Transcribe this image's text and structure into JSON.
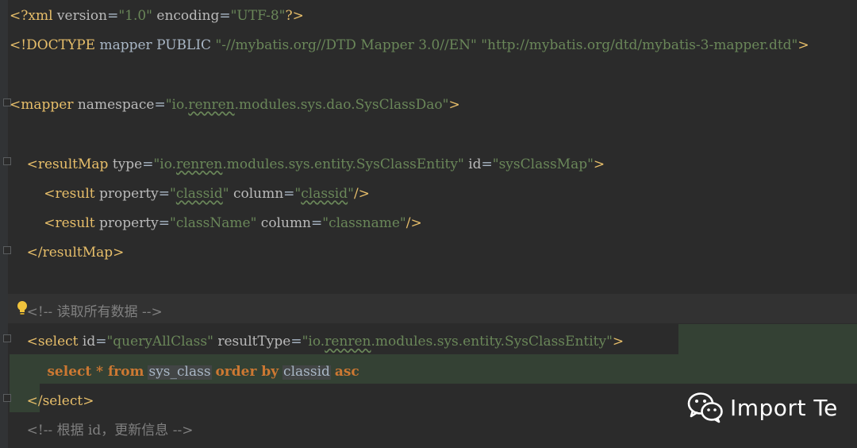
{
  "lines": [
    {
      "name": "xml-declaration-line",
      "segments": [
        {
          "t": "<?xml ",
          "c": "bracket"
        },
        {
          "t": "version",
          "c": "attr"
        },
        {
          "t": "=",
          "c": "pl"
        },
        {
          "t": "\"1.0\"",
          "c": "val"
        },
        {
          "t": " ",
          "c": "pl"
        },
        {
          "t": "encoding",
          "c": "attr"
        },
        {
          "t": "=",
          "c": "pl"
        },
        {
          "t": "\"UTF-8\"",
          "c": "val"
        },
        {
          "t": "?>",
          "c": "bracket"
        }
      ]
    },
    {
      "name": "doctype-line",
      "segments": [
        {
          "t": "<!DOCTYPE ",
          "c": "bracket"
        },
        {
          "t": "mapper PUBLIC ",
          "c": "pl"
        },
        {
          "t": "\"-//mybatis.org//DTD Mapper 3.0//EN\"",
          "c": "val"
        },
        {
          "t": " ",
          "c": "pl"
        },
        {
          "t": "\"http://mybatis.org/dtd/mybatis-3-mapper.dtd\"",
          "c": "val"
        },
        {
          "t": ">",
          "c": "bracket"
        }
      ]
    },
    {
      "name": "blank-line",
      "segments": []
    },
    {
      "name": "mapper-open-line",
      "segments": [
        {
          "t": "<mapper ",
          "c": "bracket"
        },
        {
          "t": "namespace",
          "c": "attr"
        },
        {
          "t": "=",
          "c": "pl"
        },
        {
          "t": "\"io.",
          "c": "val"
        },
        {
          "t": "renren",
          "c": "val typo"
        },
        {
          "t": ".modules.sys.dao.SysClassDao\"",
          "c": "val"
        },
        {
          "t": ">",
          "c": "bracket"
        }
      ]
    },
    {
      "name": "blank-line",
      "segments": []
    },
    {
      "name": "resultmap-open-line",
      "segments": [
        {
          "t": "    <resultMap ",
          "c": "bracket"
        },
        {
          "t": "type",
          "c": "attr"
        },
        {
          "t": "=",
          "c": "pl"
        },
        {
          "t": "\"io.",
          "c": "val"
        },
        {
          "t": "renren",
          "c": "val typo"
        },
        {
          "t": ".modules.sys.entity.SysClassEntity\"",
          "c": "val"
        },
        {
          "t": " ",
          "c": "pl"
        },
        {
          "t": "id",
          "c": "attr"
        },
        {
          "t": "=",
          "c": "pl"
        },
        {
          "t": "\"sysClassMap\"",
          "c": "val"
        },
        {
          "t": ">",
          "c": "bracket"
        }
      ]
    },
    {
      "name": "result-classid-line",
      "segments": [
        {
          "t": "        <result ",
          "c": "bracket"
        },
        {
          "t": "property",
          "c": "attr"
        },
        {
          "t": "=",
          "c": "pl"
        },
        {
          "t": "\"",
          "c": "val"
        },
        {
          "t": "classid",
          "c": "val typo"
        },
        {
          "t": "\"",
          "c": "val"
        },
        {
          "t": " ",
          "c": "pl"
        },
        {
          "t": "column",
          "c": "attr"
        },
        {
          "t": "=",
          "c": "pl"
        },
        {
          "t": "\"",
          "c": "val"
        },
        {
          "t": "classid",
          "c": "val typo"
        },
        {
          "t": "\"",
          "c": "val"
        },
        {
          "t": "/>",
          "c": "bracket"
        }
      ]
    },
    {
      "name": "result-classname-line",
      "segments": [
        {
          "t": "        <result ",
          "c": "bracket"
        },
        {
          "t": "property",
          "c": "attr"
        },
        {
          "t": "=",
          "c": "pl"
        },
        {
          "t": "\"className\"",
          "c": "val"
        },
        {
          "t": " ",
          "c": "pl"
        },
        {
          "t": "column",
          "c": "attr"
        },
        {
          "t": "=",
          "c": "pl"
        },
        {
          "t": "\"classname\"",
          "c": "val"
        },
        {
          "t": "/>",
          "c": "bracket"
        }
      ]
    },
    {
      "name": "resultmap-close-line",
      "segments": [
        {
          "t": "    </resultMap>",
          "c": "bracket"
        }
      ]
    },
    {
      "name": "blank-line",
      "segments": []
    },
    {
      "name": "comment-query-all-line",
      "segments": [
        {
          "t": "    <!-- 读取所有数据 -->",
          "c": "cm"
        }
      ]
    },
    {
      "name": "select-open-line",
      "segments": [
        {
          "t": "    <select ",
          "c": "bracket"
        },
        {
          "t": "id",
          "c": "attr"
        },
        {
          "t": "=",
          "c": "pl"
        },
        {
          "t": "\"queryAllClass\"",
          "c": "val"
        },
        {
          "t": " ",
          "c": "pl"
        },
        {
          "t": "resultType",
          "c": "attr"
        },
        {
          "t": "=",
          "c": "pl"
        },
        {
          "t": "\"io.",
          "c": "val"
        },
        {
          "t": "renren",
          "c": "val typo"
        },
        {
          "t": ".modules.sys.entity.SysClassEntity\"",
          "c": "val"
        },
        {
          "t": ">",
          "c": "bracket"
        }
      ]
    },
    {
      "name": "sql-select-line",
      "segments": [
        {
          "t": "        select * from ",
          "c": "kw"
        },
        {
          "t": "sys_class",
          "c": "tbl"
        },
        {
          "t": " order by ",
          "c": "kw"
        },
        {
          "t": "classid",
          "c": "tbl"
        },
        {
          "t": " asc",
          "c": "kw"
        }
      ]
    },
    {
      "name": "select-close-line",
      "segments": [
        {
          "t": "    </select>",
          "c": "bracket"
        }
      ]
    },
    {
      "name": "comment-by-id-line",
      "segments": [
        {
          "t": "    <!-- 根据 id，更新信息 -->",
          "c": "cm"
        }
      ]
    }
  ],
  "watermark": {
    "text": "Import Te",
    "icon": "wechat-icon"
  },
  "colors": {
    "background": "#2b2b2b",
    "tag": "#e8bf6a",
    "attribute": "#bababa",
    "string": "#6a8759",
    "keyword": "#cc7832",
    "comment": "#808080",
    "selection": "#344134",
    "caret_row": "#323232"
  }
}
